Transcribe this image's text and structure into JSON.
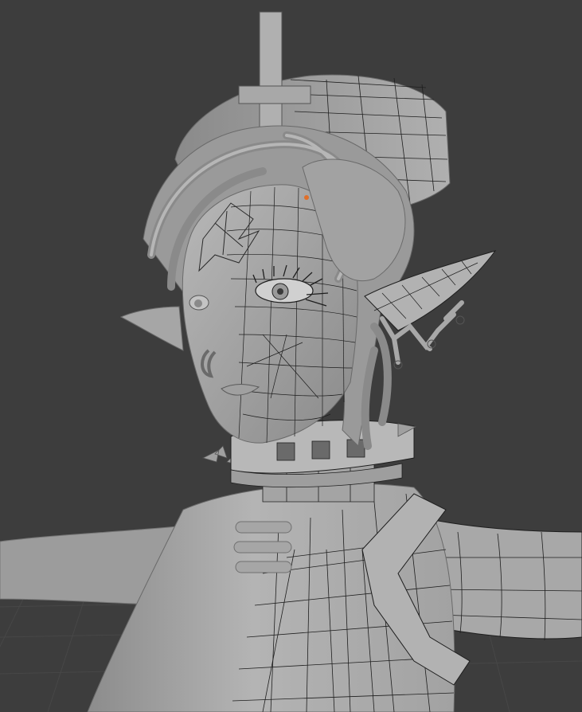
{
  "viewport": {
    "background_color": "#3d3d3d",
    "grid_line_color": "#474747",
    "mesh_fill_color": "#9a9a9a",
    "mesh_shade_color": "#6e6e6e",
    "mesh_highlight_color": "#c4c4c4",
    "wire_color": "#1e1e1e",
    "origin_point_color": "#e0702a",
    "shading_mode": "solid",
    "overlay": "wireframe"
  }
}
